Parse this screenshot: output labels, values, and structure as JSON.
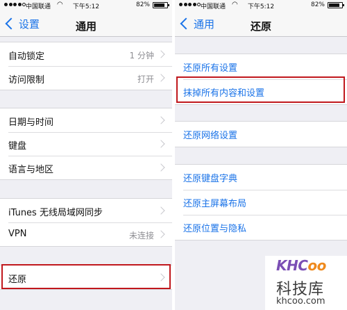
{
  "status_bar": {
    "carrier": "中国联通",
    "time": "下午5:12",
    "battery_percent": "82%",
    "battery_level": 0.82,
    "signal_bars": 5,
    "signal_filled": 4
  },
  "left_screen": {
    "nav": {
      "back_label": "设置",
      "title": "通用"
    },
    "group_1": [
      {
        "label": "自动锁定",
        "value": "1 分钟"
      },
      {
        "label": "访问限制",
        "value": "打开"
      }
    ],
    "group_2": [
      {
        "label": "日期与时间"
      },
      {
        "label": "键盘"
      },
      {
        "label": "语言与地区"
      }
    ],
    "group_3": [
      {
        "label": "iTunes 无线局域网同步"
      },
      {
        "label": "VPN",
        "value": "未连接"
      }
    ],
    "group_4": [
      {
        "label": "还原"
      }
    ]
  },
  "right_screen": {
    "nav": {
      "back_label": "通用",
      "title": "还原"
    },
    "group_1": [
      {
        "label": "还原所有设置"
      },
      {
        "label": "抹掉所有内容和设置"
      }
    ],
    "group_2": [
      {
        "label": "还原网络设置"
      }
    ],
    "group_3": [
      {
        "label": "还原键盘字典"
      },
      {
        "label": "还原主屏幕布局"
      },
      {
        "label": "还原位置与隐私"
      }
    ]
  },
  "watermark": {
    "logo_k": "KHC",
    "logo_o": "oo",
    "site_name": "科技库",
    "url": "khcoo.com"
  },
  "colors": {
    "accent": "#1a73e8",
    "highlight": "#c0171c",
    "background": "#efeff4"
  }
}
